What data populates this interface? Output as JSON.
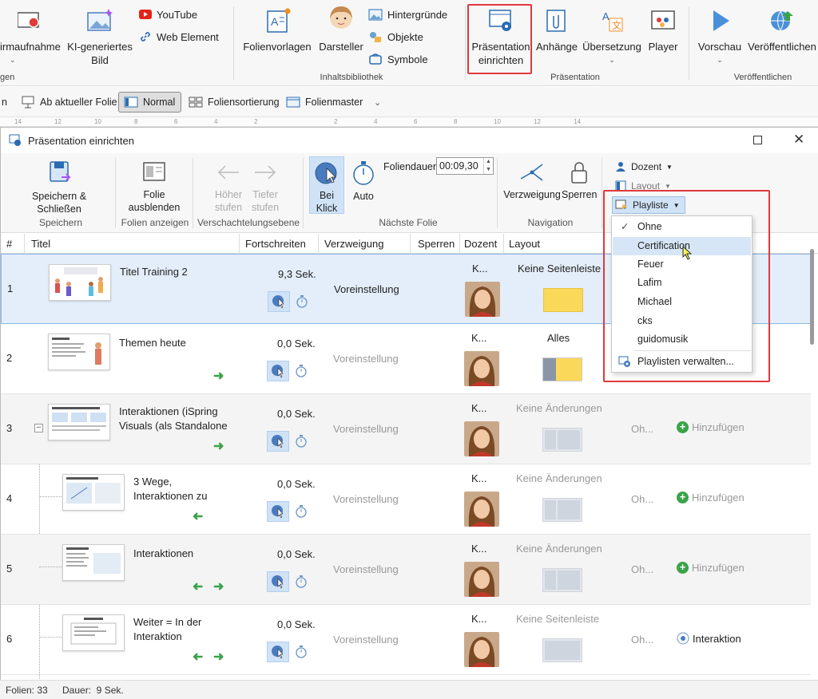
{
  "ribbon": {
    "items": {
      "screen_rec": "irmaufnahme",
      "ai_image_1": "KI-generiertes",
      "ai_image_2": "Bild",
      "youtube": "YouTube",
      "web_element": "Web Element",
      "templates": "Folienvorlagen",
      "actors": "Darsteller",
      "backgrounds": "Hintergründe",
      "objects": "Objekte",
      "symbols": "Symbole",
      "setup_1": "Präsentation",
      "setup_2": "einrichten",
      "attachments": "Anhänge",
      "translation": "Übersetzung",
      "player": "Player",
      "preview": "Vorschau",
      "publish": "Veröffentlichen"
    },
    "groups": {
      "g1": "gen",
      "library": "Inhaltsbibliothek",
      "presentation": "Präsentation",
      "publish": "Veröffentlichen"
    }
  },
  "viewbar": {
    "from_current": "Ab aktueller Folie",
    "normal": "Normal",
    "sorter": "Foliensortierung",
    "master": "Folienmaster",
    "left_cut": "n"
  },
  "ruler": {
    "ticks": [
      "14",
      "12",
      "10",
      "8",
      "6",
      "4",
      "2",
      "",
      "2",
      "4",
      "6",
      "8",
      "10",
      "12",
      "14"
    ]
  },
  "dialog": {
    "title": "Präsentation einrichten",
    "ribbon": {
      "save_close": "Speichern & Schließen",
      "save_group": "Speichern",
      "hide_1": "Folie",
      "hide_2": "ausblenden",
      "show_group": "Folien anzeigen",
      "up_1": "Höher",
      "up_2": "stufen",
      "down_1": "Tiefer",
      "down_2": "stufen",
      "nest_group": "Verschachtelungsebene",
      "click_1": "Bei",
      "click_2": "Klick",
      "auto": "Auto",
      "duration_label": "Foliendauer:",
      "duration_value": "00:09,30",
      "next_group": "Nächste Folie",
      "branch": "Verzweigung",
      "lock": "Sperren",
      "nav_group": "Navigation",
      "presenter": "Dozent",
      "layout": "Layout",
      "playlist": "Playliste"
    },
    "columns": {
      "num": "#",
      "title": "Titel",
      "progress": "Fortschreiten",
      "branch": "Verzweigung",
      "lock": "Sperren",
      "presenter": "Dozent",
      "layout": "Layout"
    },
    "rows": [
      {
        "num": "1",
        "title1": "Titel Training 2",
        "title2": "",
        "progress": "9,3 Sek.",
        "branch": "Voreinstellung",
        "presenter": "K...",
        "layout": "Keine Seitenleiste",
        "extra": "",
        "action": ""
      },
      {
        "num": "2",
        "title1": "Themen heute",
        "title2": "",
        "progress": "0,0 Sek.",
        "branch": "Voreinstellung",
        "presenter": "K...",
        "layout": "Alles",
        "extra": "",
        "action": ""
      },
      {
        "num": "3",
        "title1": "Interaktionen (iSpring",
        "title2": "Visuals (als Standalone",
        "progress": "0,0 Sek.",
        "branch": "Voreinstellung",
        "presenter": "K...",
        "layout": "Keine Änderungen",
        "extra": "Oh...",
        "action": "Hinzufügen"
      },
      {
        "num": "4",
        "title1": "3 Wege,",
        "title2": "Interaktionen zu",
        "progress": "0,0 Sek.",
        "branch": "Voreinstellung",
        "presenter": "K...",
        "layout": "Keine Änderungen",
        "extra": "Oh...",
        "action": "Hinzufügen"
      },
      {
        "num": "5",
        "title1": "Interaktionen",
        "title2": "",
        "progress": "0,0 Sek.",
        "branch": "Voreinstellung",
        "presenter": "K...",
        "layout": "Keine Änderungen",
        "extra": "Oh...",
        "action": "Hinzufügen"
      },
      {
        "num": "6",
        "title1": "Weiter = In der",
        "title2": "Interaktion",
        "progress": "0,0 Sek.",
        "branch": "Voreinstellung",
        "presenter": "K...",
        "layout": "Keine Seitenleiste",
        "extra": "Oh...",
        "action": "Interaktion"
      }
    ],
    "playlist_menu": {
      "items": [
        "Ohne",
        "Certification",
        "Feuer",
        "Lafim",
        "Michael",
        "cks",
        "guidomusik"
      ],
      "manage": "Playlisten verwalten...",
      "checked": "Ohne",
      "highlighted": "Certification"
    }
  },
  "status": {
    "slides": "Folien: 33",
    "duration": "Dauer:  9 Sek."
  },
  "colors": {
    "accent": "#2b6cb0",
    "highlight_box": "#e0393d",
    "selection": "#e3eefa",
    "arrow_green": "#3aa34a"
  }
}
